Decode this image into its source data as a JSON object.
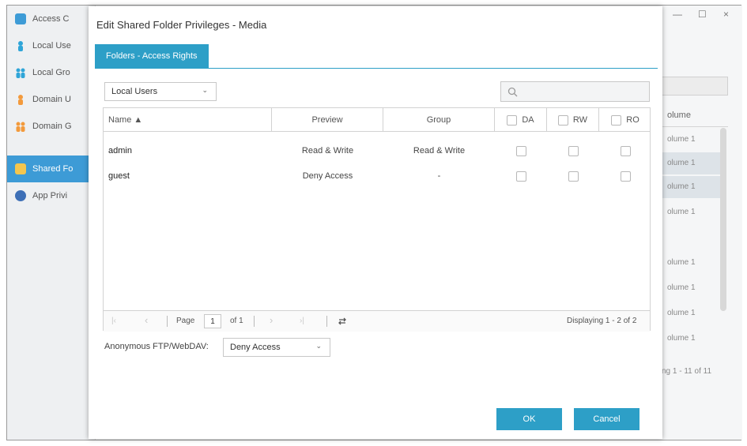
{
  "background": {
    "sidebar": [
      {
        "label": "Access C",
        "icon": "access-control-icon"
      },
      {
        "label": "Local Use",
        "icon": "user-icon"
      },
      {
        "label": "Local Gro",
        "icon": "group-icon"
      },
      {
        "label": "Domain U",
        "icon": "domain-user-icon"
      },
      {
        "label": "Domain G",
        "icon": "domain-group-icon"
      },
      {
        "label": "Shared Fo",
        "icon": "folder-icon"
      },
      {
        "label": "App Privi",
        "icon": "app-icon"
      }
    ],
    "window_controls": {
      "minimize": "—",
      "maximize": "☐",
      "close": "×"
    },
    "column_header": "olume",
    "cells": [
      "olume 1",
      "olume 1",
      "olume 1",
      "olume 1",
      "olume 1",
      "olume 1",
      "olume 1",
      "olume 1"
    ],
    "footer": "ng 1 - 11 of 11"
  },
  "dialog": {
    "title": "Edit Shared Folder Privileges - Media",
    "tab": "Folders - Access Rights",
    "user_type": "Local Users",
    "search_placeholder": "",
    "columns": {
      "name": "Name ▲",
      "preview": "Preview",
      "group": "Group",
      "da": "DA",
      "rw": "RW",
      "ro": "RO"
    },
    "rows": [
      {
        "name": "admin",
        "preview": "Read & Write",
        "group": "Read & Write",
        "da": false,
        "rw": false,
        "ro": false
      },
      {
        "name": "guest",
        "preview": "Deny Access",
        "group": "-",
        "da": false,
        "rw": false,
        "ro": false
      }
    ],
    "pagination": {
      "page_label": "Page",
      "page": "1",
      "of_label": "of 1",
      "display": "Displaying 1 - 2 of 2"
    },
    "ftp_label": "Anonymous FTP/WebDAV:",
    "ftp_value": "Deny Access",
    "ok_label": "OK",
    "cancel_label": "Cancel"
  },
  "colors": {
    "accent": "#2d9fc7",
    "sidebar_active": "#3d9bd6"
  }
}
